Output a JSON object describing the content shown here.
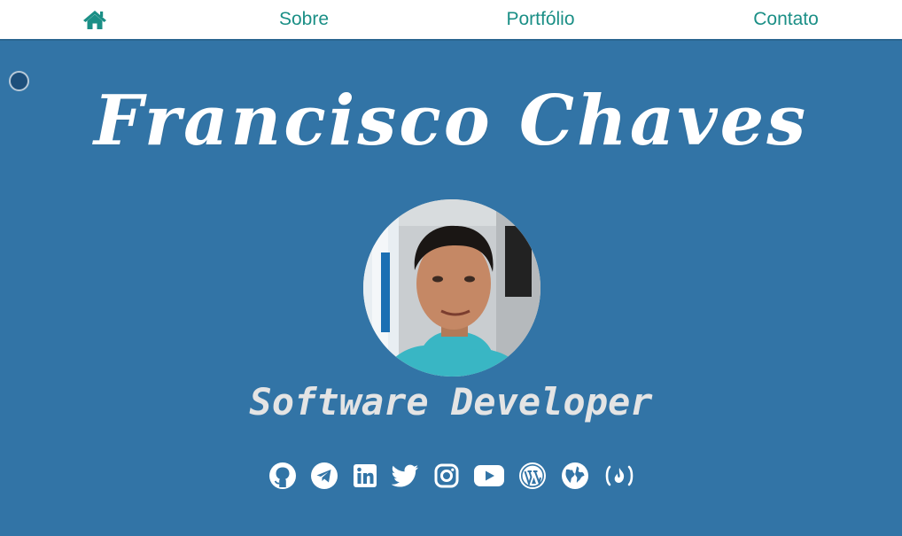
{
  "nav": {
    "home_icon": "home-icon",
    "items": [
      {
        "label": "Sobre"
      },
      {
        "label": "Portfólio"
      },
      {
        "label": "Contato"
      }
    ]
  },
  "hero": {
    "name": "Francisco Chaves",
    "role": "Software Developer"
  },
  "social": [
    {
      "icon": "github-icon"
    },
    {
      "icon": "telegram-icon"
    },
    {
      "icon": "linkedin-icon"
    },
    {
      "icon": "twitter-icon"
    },
    {
      "icon": "instagram-icon"
    },
    {
      "icon": "youtube-icon"
    },
    {
      "icon": "wordpress-icon"
    },
    {
      "icon": "globe-icon"
    },
    {
      "icon": "freecodecamp-icon"
    }
  ],
  "colors": {
    "background": "#3274a6",
    "nav_background": "#ffffff",
    "nav_text": "#1b8f86",
    "title_text": "#ffffff",
    "subtitle_text": "#e4e4e4",
    "icon_color": "#ffffff"
  }
}
